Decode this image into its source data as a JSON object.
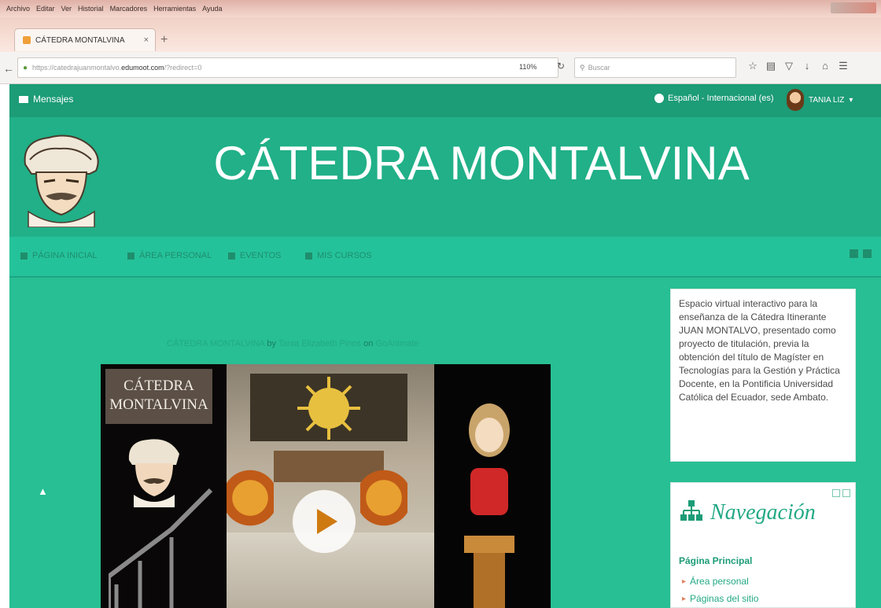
{
  "browser": {
    "menu": [
      "Archivo",
      "Editar",
      "Ver",
      "Historial",
      "Marcadores",
      "Herramientas",
      "Ayuda"
    ],
    "tab_title": "CÁTEDRA MONTALVINA",
    "tab_close": "×",
    "new_tab": "+",
    "url_prefix": "https://catedrajuanmontalvo.",
    "url_domain": "edumoot.com",
    "url_suffix": "/?redirect=0",
    "zoom": "110%",
    "search_placeholder": "Buscar"
  },
  "topnav": {
    "messages": "Mensajes",
    "language": "Español - Internacional (es)",
    "user": "TANIA LIZ"
  },
  "header": {
    "title": "CÁTEDRA MONTALVINA"
  },
  "custommenu": {
    "items": [
      "PÁGINA INICIAL",
      "ÁREA PERSONAL",
      "EVENTOS",
      "MIS CURSOS"
    ]
  },
  "embed": {
    "title": "CÁTEDRA MONTALVINA",
    "by": "by",
    "author": "Tania Elizabeth Pinos",
    "on": "on",
    "platform": "GoAnimate"
  },
  "video": {
    "label": "CÁTEDRA MONTALVINA"
  },
  "description": {
    "text": "Espacio virtual interactivo para la enseñanza de la Cátedra Itinerante JUAN MONTALVO, presentado como proyecto de titulación, previa la obtención del título de Magíster en Tecnologías para la Gestión y Práctica Docente, en la Pontificia Universidad Católica del Ecuador, sede Ambato."
  },
  "navigation": {
    "title": "Navegación",
    "main": "Página Principal",
    "items": [
      "Área personal",
      "Páginas del sitio"
    ]
  },
  "colors": {
    "accent": "#27bf93",
    "header": "#21b088",
    "topnav": "#1c9c77"
  }
}
